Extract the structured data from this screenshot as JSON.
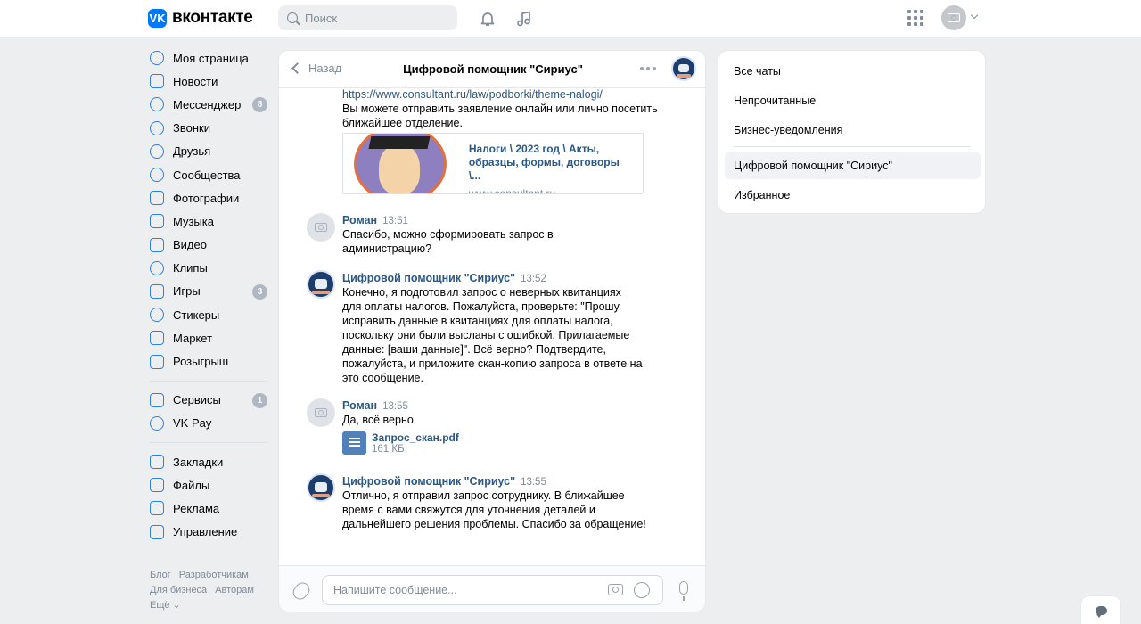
{
  "header": {
    "logo_letter": "VK",
    "logo_text": "вконтакте",
    "search_placeholder": "Поиск",
    "icons": [
      "bell-icon",
      "music-icon",
      "apps-grid-icon",
      "camera-icon",
      "chevron-down-icon"
    ]
  },
  "nav": {
    "items": [
      {
        "label": "Моя страница",
        "icon": "user-circle-icon"
      },
      {
        "label": "Новости",
        "icon": "news-icon"
      },
      {
        "label": "Мессенджер",
        "icon": "message-icon",
        "badge": "8"
      },
      {
        "label": "Звонки",
        "icon": "phone-icon"
      },
      {
        "label": "Друзья",
        "icon": "friends-icon"
      },
      {
        "label": "Сообщества",
        "icon": "communities-icon"
      },
      {
        "label": "Фотографии",
        "icon": "photo-icon"
      },
      {
        "label": "Музыка",
        "icon": "music-icon"
      },
      {
        "label": "Видео",
        "icon": "video-icon"
      },
      {
        "label": "Клипы",
        "icon": "clips-icon"
      },
      {
        "label": "Игры",
        "icon": "games-icon",
        "badge": "3"
      },
      {
        "label": "Стикеры",
        "icon": "stickers-icon"
      },
      {
        "label": "Маркет",
        "icon": "market-icon"
      },
      {
        "label": "Розыгрыш",
        "icon": "gift-icon"
      }
    ],
    "items2": [
      {
        "label": "Сервисы",
        "icon": "services-icon",
        "badge": "1"
      },
      {
        "label": "VK Pay",
        "icon": "ruble-icon"
      }
    ],
    "items3": [
      {
        "label": "Закладки",
        "icon": "bookmark-icon"
      },
      {
        "label": "Файлы",
        "icon": "file-icon"
      },
      {
        "label": "Реклама",
        "icon": "megaphone-icon"
      },
      {
        "label": "Управление",
        "icon": "manage-icon"
      }
    ],
    "footer": {
      "blog": "Блог",
      "devs": "Разработчикам",
      "business": "Для бизнеса",
      "authors": "Авторам",
      "more": "Ещё ⌄"
    }
  },
  "chat": {
    "back_label": "Назад",
    "title": "Цифровой помощник \"Сириус\"",
    "top_link": "https://www.consultant.ru/law/podborki/theme-nalogi/",
    "top_text_1": "Вы можете отправить заявление онлайн или лично посетить",
    "top_text_2": "ближайшее отделение.",
    "link_card": {
      "title_1": "Налоги \\ 2023 год \\ Акты,",
      "title_2": "образцы, формы, договоры \\...",
      "domain": "www.consultant.ru"
    },
    "messages": [
      {
        "author": "Роман",
        "time": "13:51",
        "lines": [
          "Спасибо, можно сформировать запрос в",
          "администрацию?"
        ]
      },
      {
        "author": "Цифровой помощник \"Сириус\"",
        "time": "13:52",
        "lines": [
          "Конечно, я подготовил запрос о неверных квитанциях",
          "для оплаты налогов. Пожалуйста, проверьте: \"Прошу",
          "исправить данные в квитанциях для оплаты налога,",
          "поскольку они были высланы с ошибкой. Прилагаемые",
          "данные: [ваши данные]\". Всё верно? Подтвердите,",
          "пожалуйста, и приложите скан-копию запроса в ответе на",
          "это сообщение."
        ]
      },
      {
        "author": "Роман",
        "time": "13:55",
        "lines": [
          "Да, всё верно"
        ],
        "file": {
          "name": "Запрос_скан.pdf",
          "size": "161 КБ"
        }
      },
      {
        "author": "Цифровой помощник \"Сириус\"",
        "time": "13:55",
        "lines": [
          "Отлично, я отправил запрос сотруднику. В ближайшее",
          "время с вами свяжутся для уточнения деталей и",
          "дальнейшего решения проблемы. Спасибо за обращение!"
        ]
      }
    ],
    "composer_placeholder": "Напишите сообщение..."
  },
  "right_panel": {
    "items": [
      "Все чаты",
      "Непрочитанные",
      "Бизнес-уведомления"
    ],
    "items2": [
      "Цифровой помощник \"Сириус\"",
      "Избранное"
    ]
  },
  "colors": {
    "accent": "#2d81e0",
    "link": "#2a5885",
    "bg": "#edeef0",
    "logo": "#0077ff"
  }
}
